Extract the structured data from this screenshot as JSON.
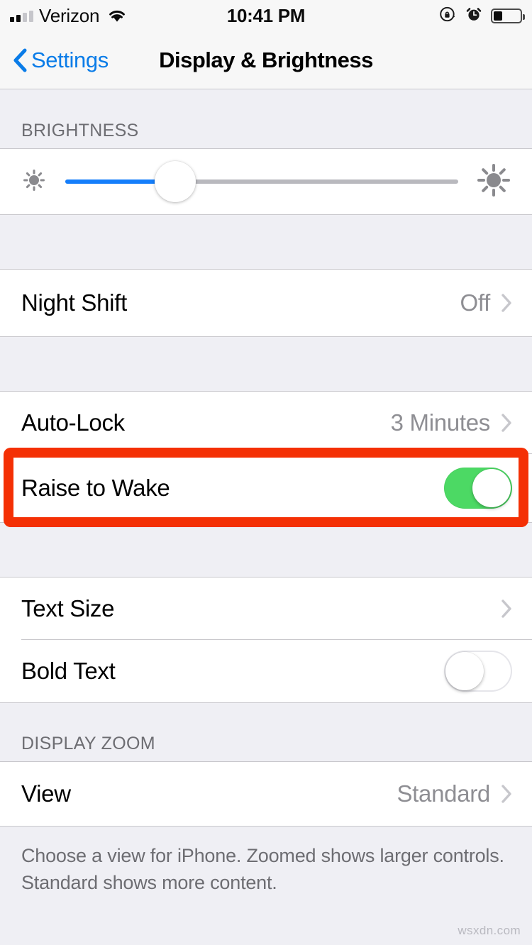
{
  "status_bar": {
    "carrier": "Verizon",
    "time": "10:41 PM",
    "signal_bars_filled": 2,
    "signal_bars_total": 4,
    "wifi_icon": "wifi-icon",
    "rotation_lock_icon": "rotation-lock-icon",
    "alarm_icon": "alarm-clock-icon",
    "battery_icon": "battery-icon",
    "battery_level_percent": 30
  },
  "nav": {
    "back_label": "Settings",
    "back_icon": "chevron-left-icon",
    "title": "Display & Brightness"
  },
  "brightness": {
    "header": "BRIGHTNESS",
    "slider_value_percent": 28,
    "low_icon": "sun-dim-icon",
    "high_icon": "sun-bright-icon"
  },
  "night_shift": {
    "label": "Night Shift",
    "value": "Off",
    "chevron_icon": "chevron-right-icon"
  },
  "lock_group": {
    "auto_lock": {
      "label": "Auto-Lock",
      "value": "3 Minutes",
      "chevron_icon": "chevron-right-icon"
    },
    "raise_to_wake": {
      "label": "Raise to Wake",
      "toggle_state": "on"
    }
  },
  "text_group": {
    "text_size": {
      "label": "Text Size",
      "chevron_icon": "chevron-right-icon"
    },
    "bold_text": {
      "label": "Bold Text",
      "toggle_state": "off"
    }
  },
  "display_zoom": {
    "header": "DISPLAY ZOOM",
    "view": {
      "label": "View",
      "value": "Standard",
      "chevron_icon": "chevron-right-icon"
    },
    "footer": "Choose a view for iPhone. Zoomed shows larger controls. Standard shows more content."
  },
  "annotation": {
    "color": "#F43005",
    "target": "raise-to-wake-row"
  },
  "watermark": "wsxdn.com",
  "colors": {
    "accent_blue": "#157EFB",
    "link_blue": "#0A7CE8",
    "toggle_green": "#4CD964",
    "background_gray": "#EFEFF4",
    "value_gray": "#8E8E93"
  }
}
